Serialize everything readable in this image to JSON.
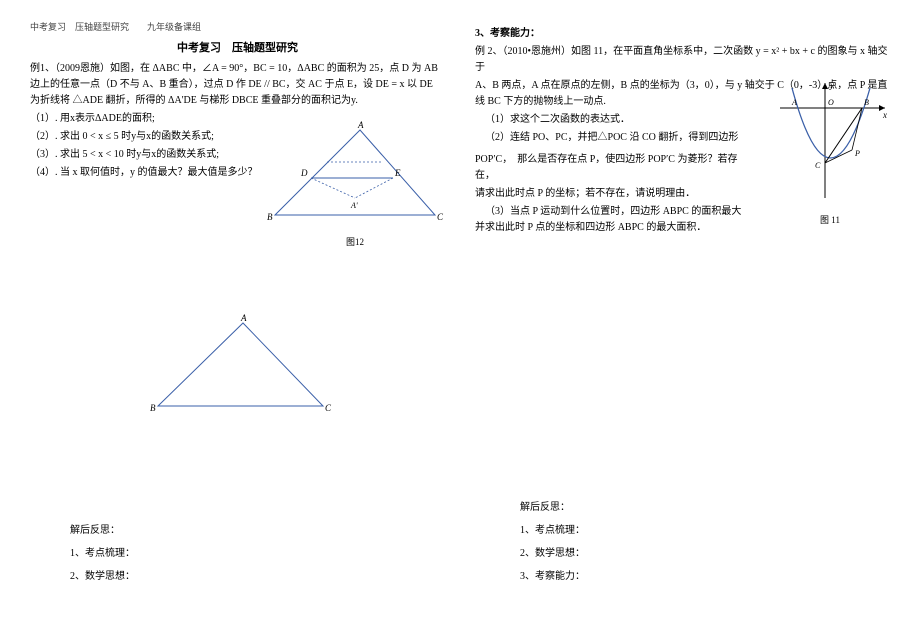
{
  "left": {
    "header": "中考复习　压轴题型研究　　九年级备课组",
    "title": "中考复习　压轴题型研究",
    "p1": "例1、（2009恩施）如图，在 ΔABC 中，∠A = 90°，BC = 10，ΔABC 的面积为 25，点 D 为 AB 边上的任意一点（D 不与 A、B 重合），过点 D 作 DE // BC，交 AC 于点 E，设 DE = x 以 DE 为折线将 △ADE 翻折，所得的 ΔA'DE 与梯形 DBCE 重叠部分的面积记为y.",
    "q1": "（1）. 用x表示ΔADE的面积;",
    "q2": "（2）. 求出 0 < x ≤ 5 时y与x的函数关系式;",
    "q3": "（3）. 求出 5 < x < 10 时y与x的函数关系式;",
    "q4": "（4）. 当 x 取何值时，y 的值最大？最大值是多少？",
    "fig1_caption": "图12"
  },
  "right": {
    "section3": "3、考察能力：",
    "p1": "例 2、（2010•恩施州）如图 11，在平面直角坐标系中，二次函数 y = x² + bx + c 的图象与 x 轴交于",
    "p2": "A、B 两点，A 点在原点的左侧，B 点的坐标为（3，0），与 y 轴交于 C（0，-3）点，点 P 是直线 BC 下方的抛物线上一动点.",
    "q1": "（1）求这个二次函数的表达式．",
    "q2": "（2）连结 PO、PC，并把△POC 沿 CO 翻折，得到四边形",
    "q2b": "POP′C，　那么是否存在点 P，使四边形 POP′C 为菱形？若存在，",
    "q2c": "请求出此时点 P 的坐标；若不存在，请说明理由．",
    "q3": "（3）当点 P 运动到什么位置时，四边形 ABPC 的面积最大并求出此时 P 点的坐标和四边形 ABPC 的最大面积．",
    "fig_caption": "图 11"
  },
  "bottom_left": {
    "l1": "解后反思：",
    "l2": "1、考点梳理：",
    "l3": "2、数学思想："
  },
  "bottom_right": {
    "l1": "解后反思：",
    "l2": "1、考点梳理：",
    "l3": "2、数学思想：",
    "l4": "3、考察能力："
  }
}
